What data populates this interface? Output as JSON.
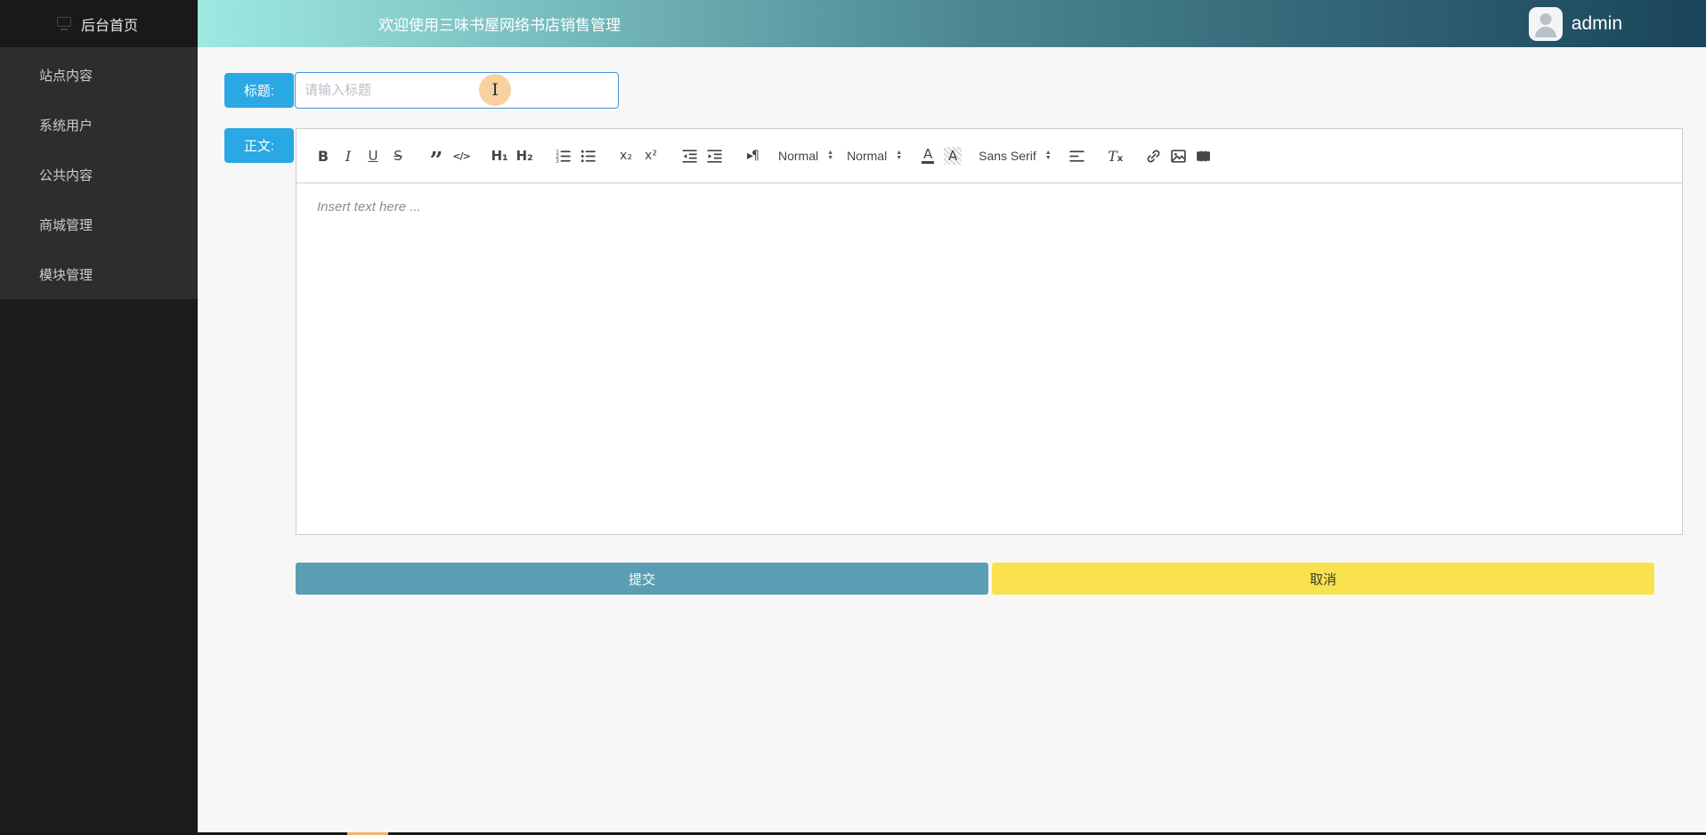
{
  "sidebar": {
    "home_label": "后台首页",
    "items": [
      {
        "label": "站点内容"
      },
      {
        "label": "系统用户"
      },
      {
        "label": "公共内容"
      },
      {
        "label": "商城管理"
      },
      {
        "label": "模块管理"
      }
    ]
  },
  "header": {
    "welcome_text": "欢迎使用三味书屋网络书店销售管理",
    "username": "admin"
  },
  "form": {
    "title_label": "标题:",
    "title_placeholder": "请输入标题",
    "body_label": "正文:",
    "editor_placeholder": "Insert text here ...",
    "submit_label": "提交",
    "cancel_label": "取消"
  },
  "toolbar": {
    "bold": "B",
    "italic": "I",
    "underline": "U",
    "strike": "S",
    "blockquote": "”",
    "code": "</>",
    "header1": "H₁",
    "header2": "H₂",
    "subscript": "x₂",
    "superscript": "x²",
    "direction": "▸¶",
    "size_value": "Normal",
    "header_value": "Normal",
    "color_letter": "A",
    "background_letter": "A",
    "font_value": "Sans Serif",
    "clean_t": "T",
    "clean_x": "x",
    "icons": [
      "ordered-list",
      "bullet-list",
      "outdent",
      "indent",
      "align",
      "clean",
      "link",
      "image",
      "video"
    ]
  },
  "cursor": {
    "glyph": "I"
  },
  "colors": {
    "accent_blue": "#29a8e3",
    "submit_teal": "#5b9db2",
    "cancel_yellow": "#f9e24e",
    "header_gradient_start": "#9ee9e2",
    "header_gradient_end": "#1a4459",
    "sidebar_dark": "#2d2d30"
  }
}
